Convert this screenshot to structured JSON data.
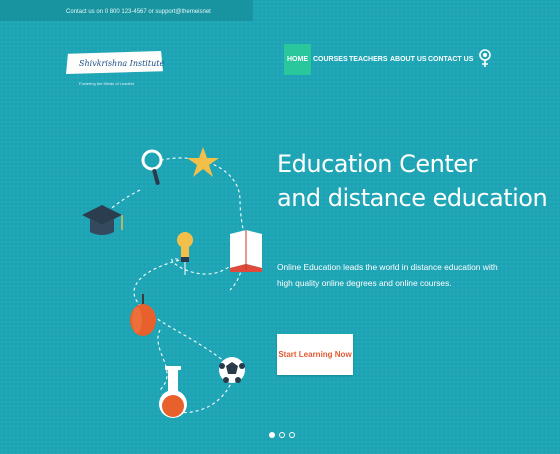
{
  "header": {
    "contact_line": "Contact us on 0 800 123-4567 or support@themeisnet"
  },
  "logo": {
    "name": "Shivkrishna Institute",
    "tagline": "Fostering the Minds of Leaders"
  },
  "nav": {
    "items": [
      {
        "label": "HOME",
        "active": true
      },
      {
        "label": "COURSES",
        "active": false
      },
      {
        "label": "TEACHERS",
        "active": false
      },
      {
        "label": "ABOUT US",
        "active": false
      },
      {
        "label": "CONTACT US",
        "active": false
      }
    ],
    "search_icon": "search-icon"
  },
  "hero": {
    "title_line1": "Education Center",
    "title_line2": "and distance education",
    "description": "Online Education leads the world in distance education with high quality online degrees and online courses.",
    "cta_label": "Start Learning Now"
  },
  "illustration": {
    "icons": [
      "magnifier-icon",
      "star-icon",
      "graduation-cap-icon",
      "lightbulb-icon",
      "book-icon",
      "apple-icon",
      "soccer-ball-icon",
      "flask-icon"
    ]
  },
  "slider": {
    "slide_count": 3,
    "active_index": 0
  },
  "colors": {
    "background": "#1da5b5",
    "nav_active": "#29c79b",
    "cta_text": "#e25b32"
  }
}
